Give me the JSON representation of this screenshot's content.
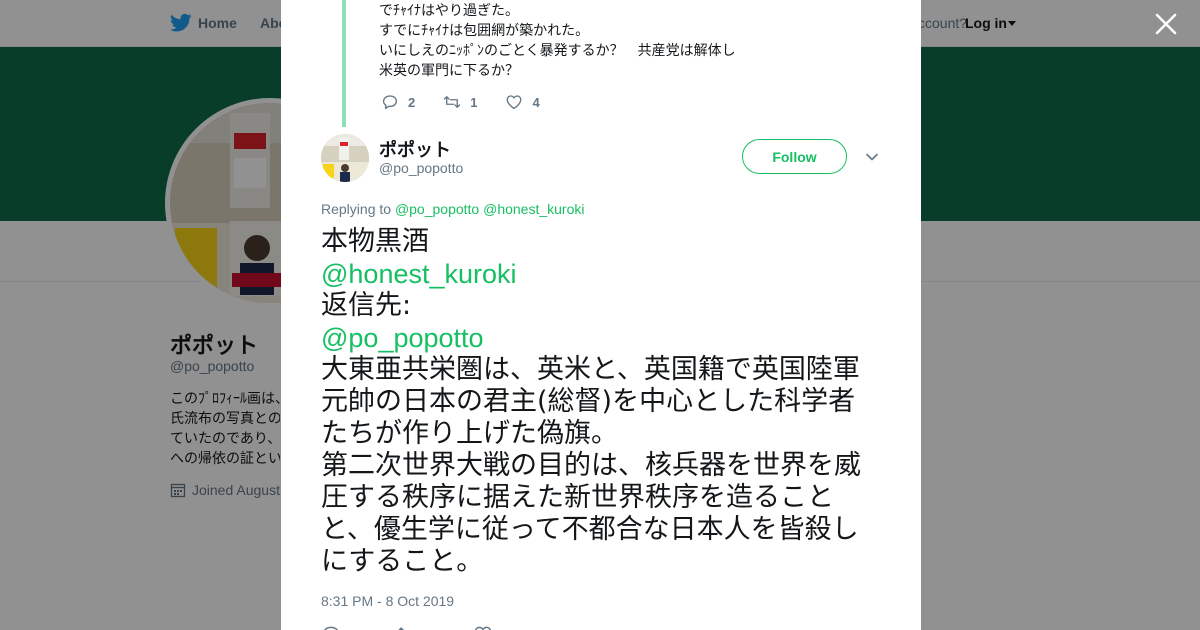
{
  "nav": {
    "home_label": "Home",
    "about_label": "Abo",
    "account_prompt": "ccount?",
    "login_label": "Log in"
  },
  "colors": {
    "banner": "#0e6b48",
    "accent": "#17bf63",
    "thread_line": "#8de1b5"
  },
  "profile": {
    "name": "ポポット",
    "handle": "@po_popotto",
    "bio_fragment": "このﾌﾟﾛﾌｨｰﾙ画は、\n氏流布の写真との\nていたのであり、\nへの帰依の証とい",
    "joined_label": "Joined August"
  },
  "previous_tweet": {
    "lines": [
      "でﾁｬｲﾅはやり過ぎた。",
      "すでにﾁｬｲﾅは包囲網が築かれた。",
      "いにしえのﾆｯﾎﾟﾝのごとく暴発するか？　共産党は解体し",
      "米英の軍門に下るか？"
    ],
    "replies": "2",
    "retweets": "1",
    "likes": "4"
  },
  "tweet": {
    "author_name": "ポポット",
    "author_handle": "@po_popotto",
    "follow_label": "Follow",
    "replying_prefix": "Replying to",
    "replying_mention_1": "@po_popotto",
    "replying_mention_2": "@honest_kuroki",
    "body_line_1": "本物黒酒",
    "body_mention_1": "@honest_kuroki",
    "body_line_2": "返信先:",
    "body_mention_2": "@po_popotto",
    "body_line_3": "大東亜共栄圏は、英米と、英国籍で英国陸軍",
    "body_line_4": "元帥の日本の君主(総督)を中心とした科学者",
    "body_line_5": "たちが作り上げた偽旗。",
    "body_line_6": "第二次世界大戦の目的は、核兵器を世界を威",
    "body_line_7": "圧する秩序に据えた新世界秩序を造ること",
    "body_line_8": "と、優生学に従って不都合な日本人を皆殺し",
    "body_line_9": "にすること。",
    "timestamp": "8:31 PM - 8 Oct 2019"
  },
  "icons": [
    "twitter-bird-icon",
    "close-icon",
    "reply-icon",
    "retweet-icon",
    "like-icon",
    "chevron-down-icon",
    "calendar-icon"
  ]
}
